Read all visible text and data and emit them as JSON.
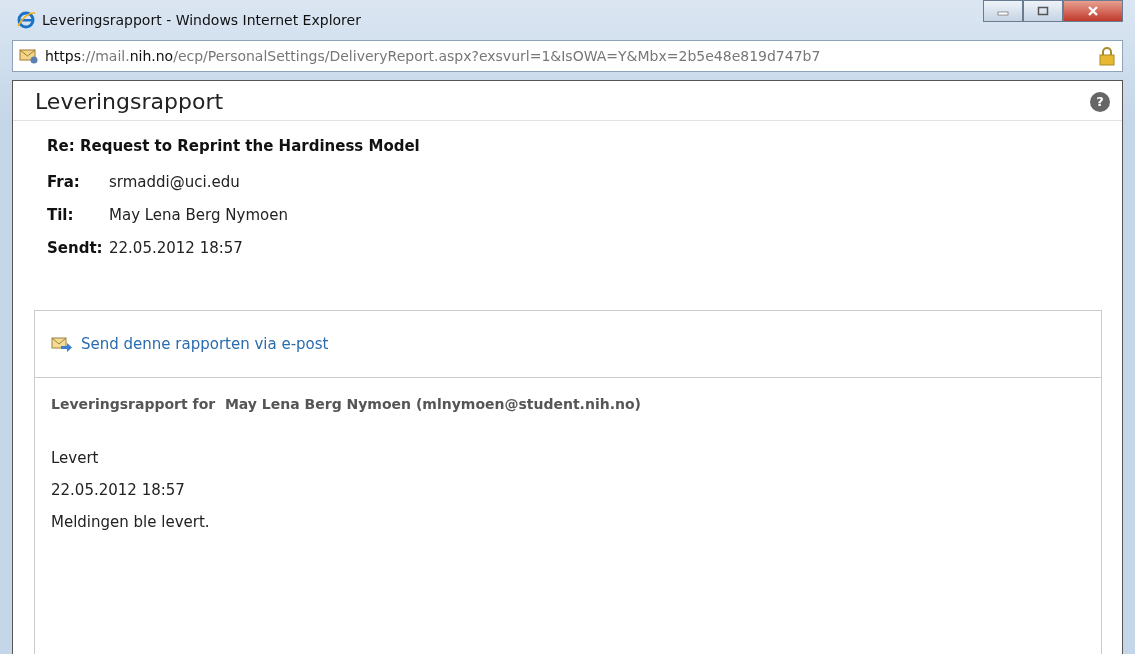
{
  "window": {
    "title": "Leveringsrapport - Windows Internet Explorer"
  },
  "address_bar": {
    "url": "**https**://mail.**nih.no**/ecp/PersonalSettings/DeliveryReport.aspx?exsvurl=1&IsOWA=Y&Mbx=2b5e48e819d747b7"
  },
  "page": {
    "title": "Leveringsrapport",
    "help": "?",
    "subject": "Re: Request to Reprint the Hardiness Model",
    "fields": [
      {
        "label": "Fra:",
        "value": "srmaddi@uci.edu"
      },
      {
        "label": "Til:",
        "value": "May Lena Berg Nymoen"
      },
      {
        "label": "Sendt:",
        "value": "22.05.2012 18:57"
      }
    ],
    "report": {
      "link": "Send denne rapporten via e-post",
      "heading": "Leveringsrapport for  May Lena Berg Nymoen (mlnymoen@student.nih.no)",
      "lines": [
        "Levert",
        "22.05.2012 18:57",
        "Meldingen ble levert."
      ]
    }
  }
}
